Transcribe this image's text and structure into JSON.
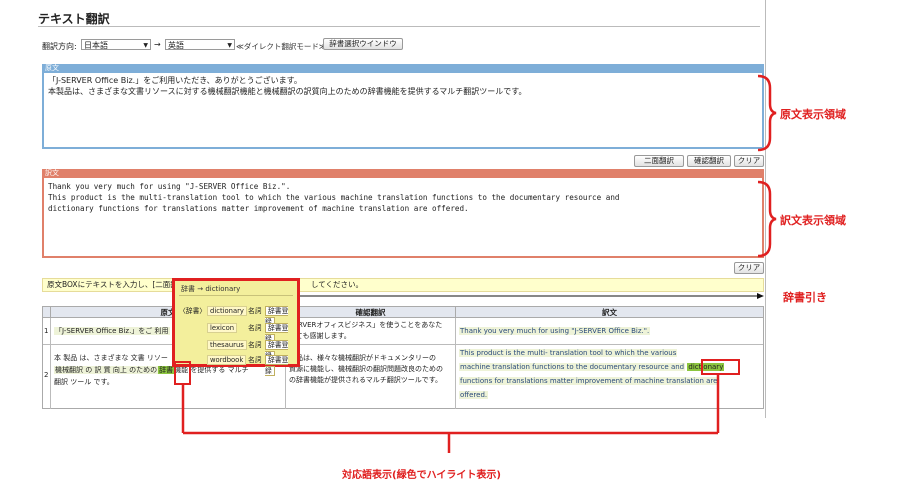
{
  "page_title": "テキスト翻訳",
  "direction": {
    "label": "翻訳方向:",
    "source_lang": "日本語",
    "target_lang": "英語",
    "arrow": "→",
    "mode_link": "≪ダイレクト翻訳モード≫",
    "dict_window_button": "辞書選択ウインドウ"
  },
  "source_panel": {
    "header": "原文",
    "line1": "「J-SERVER Office Biz.」をご利用いただき、ありがとうございます。",
    "line2": "本製品は、さまざまな文書リソースに対する機械翻訳機能と機械翻訳の訳質向上のための辞書機能を提供するマルチ翻訳ツールです。"
  },
  "buttons": {
    "dual_translate": "二面翻訳",
    "confirm_translate": "確認翻訳",
    "clear": "クリア",
    "clear2": "クリア"
  },
  "target_panel": {
    "header": "訳文",
    "line1": "Thank you very much for using \"J-SERVER Office Biz.\".",
    "line2": "This product is the multi-translation tool to which the various machine translation functions to the documentary resource and",
    "line3": "dictionary functions for translations matter improvement of machine translation are offered."
  },
  "info_bar": {
    "text_left": "原文BOXにテキストを入力し、[二面翻",
    "text_right": "してください。"
  },
  "table": {
    "headers": {
      "source": "原文",
      "confirm": "確認翻訳",
      "target": "訳文"
    },
    "row1": {
      "num": "1",
      "source": "「J-SERVER Office Biz.」をご 利用",
      "confirm_a": "SERVERオフィスビジネス」を使うことをあなた",
      "confirm_b": "とても感謝します。",
      "target": "Thank you very much for using \"J-SERVER Office Biz.\"."
    },
    "row2": {
      "num": "2",
      "source_a": "本 製品 は、さまざまな 文書 リソー",
      "source_b": "機械翻訳 の 訳 質 向上 のための",
      "source_hl": "辞書",
      "source_c": "機能 を提供する マルチ",
      "source_d": "翻訳 ツール です。",
      "confirm_a": "製品は、様々な機械翻訳がドキュメンタリーの",
      "confirm_b": "資源に機能し、機械翻訳の翻訳問題改良のための",
      "confirm_c": "の辞書機能が提供されるマルチ翻訳ツールです。",
      "target_a": "This product is the multi- translation tool to which the various",
      "target_b": "machine translation functions to the documentary resource and",
      "target_hl": "dictionary",
      "target_c": "functions for translations matter improvement of machine translation are",
      "target_d": "offered."
    }
  },
  "dict_popup": {
    "title": "辞書 → dictionary",
    "side_label": "〈辞書〉",
    "pos": "名詞",
    "register": "辞書登録",
    "entries": [
      "dictionary",
      "lexicon",
      "thesaurus",
      "wordbook"
    ]
  },
  "annotations": {
    "source_area": "原文表示領域",
    "target_area": "訳文表示領域",
    "dict_lookup": "辞書引き",
    "correspondence": "対応語表示(緑色でハイライト表示)"
  },
  "colors": {
    "source_header": "#7eaed8",
    "target_header": "#e0806a",
    "highlight": "#8cc63f",
    "annotation_red": "#e02020",
    "popup_bg": "#f3ef9c"
  }
}
